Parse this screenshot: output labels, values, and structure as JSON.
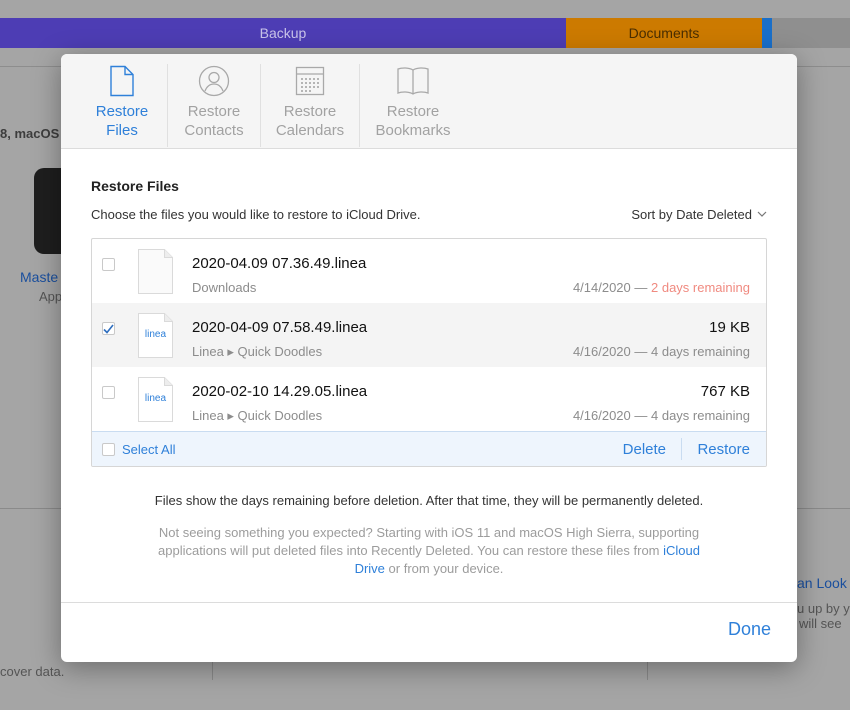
{
  "background": {
    "storage_bar": {
      "backup_label": "Backup",
      "documents_label": "Documents"
    },
    "sidebar_text": "8, macOS",
    "app_link": "Maste",
    "app_sub": "App",
    "right_link": "an Look",
    "right_text_1": "u up by y",
    "right_text_2": "will see",
    "bottom_text": "cover data."
  },
  "tabs": [
    {
      "label": "Restore\nFiles",
      "icon": "document-icon",
      "active": true
    },
    {
      "label": "Restore\nContacts",
      "icon": "contacts-icon",
      "active": false
    },
    {
      "label": "Restore\nCalendars",
      "icon": "calendar-icon",
      "active": false
    },
    {
      "label": "Restore\nBookmarks",
      "icon": "bookmarks-icon",
      "active": false
    }
  ],
  "section": {
    "title": "Restore Files",
    "instruction": "Choose the files you would like to restore to iCloud Drive.",
    "sort_label": "Sort by Date Deleted"
  },
  "files": [
    {
      "name": "2020-04.09 07.36.49.linea",
      "size": "",
      "location": "Downloads",
      "date": "4/14/2020 — ",
      "remaining": "2 days remaining",
      "checked": false,
      "icon_label": ""
    },
    {
      "name": "2020-04-09 07.58.49.linea",
      "size": "19 KB",
      "location": "Linea ▸ Quick Doodles",
      "date": "4/16/2020 — ",
      "remaining": "4 days remaining",
      "checked": true,
      "icon_label": "linea"
    },
    {
      "name": "2020-02-10 14.29.05.linea",
      "size": "767 KB",
      "location": "Linea ▸ Quick Doodles",
      "date": "4/16/2020 — ",
      "remaining": "4 days remaining",
      "checked": false,
      "icon_label": "linea"
    }
  ],
  "actions": {
    "select_all": "Select All",
    "delete": "Delete",
    "restore": "Restore"
  },
  "note": "Files show the days remaining before deletion. After that time, they will be permanently deleted.",
  "help": {
    "text_before": "Not seeing something you expected? Starting with iOS 11 and macOS High Sierra, supporting applications will put deleted files into Recently Deleted. You can restore these files from ",
    "link": "iCloud Drive",
    "text_after": " or from your device."
  },
  "footer": {
    "done": "Done"
  },
  "colors": {
    "accent": "#2f80d9",
    "warning": "#f08a80",
    "backup": "#4d3db4",
    "documents": "#cc7a00"
  }
}
